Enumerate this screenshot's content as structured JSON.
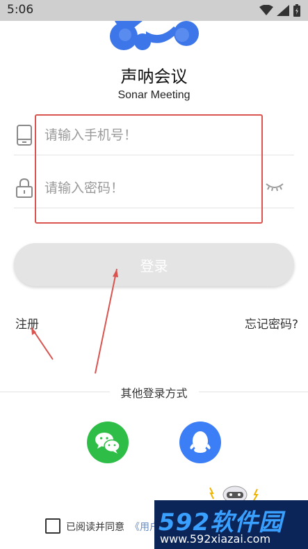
{
  "status_bar": {
    "time": "5:06",
    "icons": [
      "wifi-icon",
      "signal-icon",
      "battery-charging-icon"
    ]
  },
  "app": {
    "title": "声呐会议",
    "subtitle": "Sonar Meeting",
    "logo_color": "#3d76e8"
  },
  "form": {
    "phone": {
      "placeholder": "请输入手机号！",
      "value": "",
      "icon": "phone-icon"
    },
    "password": {
      "placeholder": "请输入密码！",
      "value": "",
      "icon": "lock-icon",
      "toggle_icon": "eye-closed-icon"
    },
    "login_label": "登录"
  },
  "links": {
    "register": "注册",
    "forgot": "忘记密码?"
  },
  "other_login": {
    "label": "其他登录方式",
    "methods": [
      {
        "name": "wechat",
        "icon": "wechat-icon",
        "color": "#2ebd47"
      },
      {
        "name": "qq",
        "icon": "qq-icon",
        "color": "#3b7ef5"
      }
    ]
  },
  "agreement": {
    "checked": false,
    "text": "已阅读并同意",
    "link": "《用户"
  },
  "annotation_color": "#d9534f",
  "watermark": {
    "logo": "592软件园",
    "url": "www.592xiazai.com"
  }
}
